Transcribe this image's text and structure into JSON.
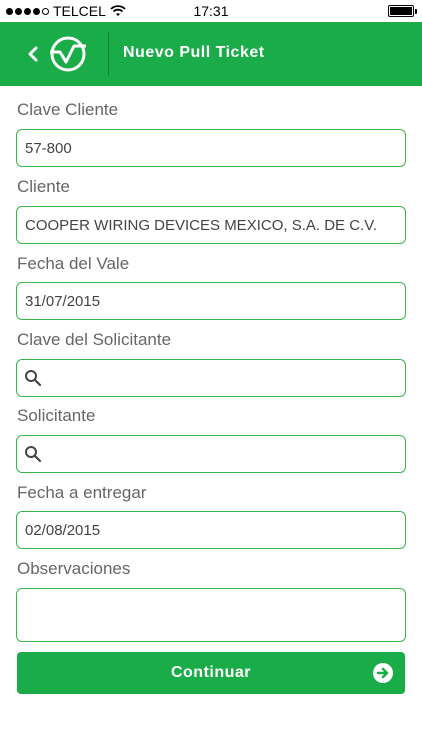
{
  "status_bar": {
    "carrier": "TELCEL",
    "time": "17:31"
  },
  "header": {
    "title": "Nuevo Pull Ticket",
    "back_icon": "chevron-left-icon",
    "logo_icon": "logo-icon"
  },
  "form": {
    "clave_cliente": {
      "label": "Clave Cliente",
      "value": "57-800"
    },
    "cliente": {
      "label": "Cliente",
      "value": "COOPER WIRING DEVICES MEXICO, S.A. DE C.V."
    },
    "fecha_vale": {
      "label": "Fecha del Vale",
      "value": "31/07/2015"
    },
    "clave_solicitante": {
      "label": "Clave del Solicitante",
      "value": ""
    },
    "solicitante": {
      "label": "Solicitante",
      "value": ""
    },
    "fecha_entregar": {
      "label": "Fecha a entregar",
      "value": "02/08/2015"
    },
    "observaciones": {
      "label": "Observaciones",
      "value": ""
    }
  },
  "continue_button": {
    "label": "Continuar"
  },
  "colors": {
    "brand_green": "#1aac48",
    "field_border": "#3cb54a",
    "label_gray": "#666666"
  }
}
